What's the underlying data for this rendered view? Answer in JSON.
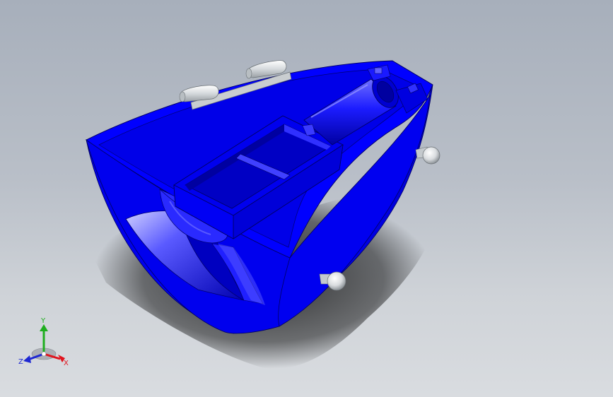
{
  "viewport": {
    "background_top": "#a7afbb",
    "background_bottom": "#d9dce0"
  },
  "model": {
    "body_color": "#0000ff",
    "body_dark": "#0000c8",
    "body_deep": "#00008a",
    "body_light": "#4a4aff",
    "highlight": "#c8c8ff",
    "edge_color": "#000060",
    "pin_color": "#e6e8ea"
  },
  "triad": {
    "x_label": "X",
    "y_label": "Y",
    "z_label": "Z",
    "x_color": "#e0141e",
    "y_color": "#1fae1f",
    "z_color": "#1e28d2"
  }
}
